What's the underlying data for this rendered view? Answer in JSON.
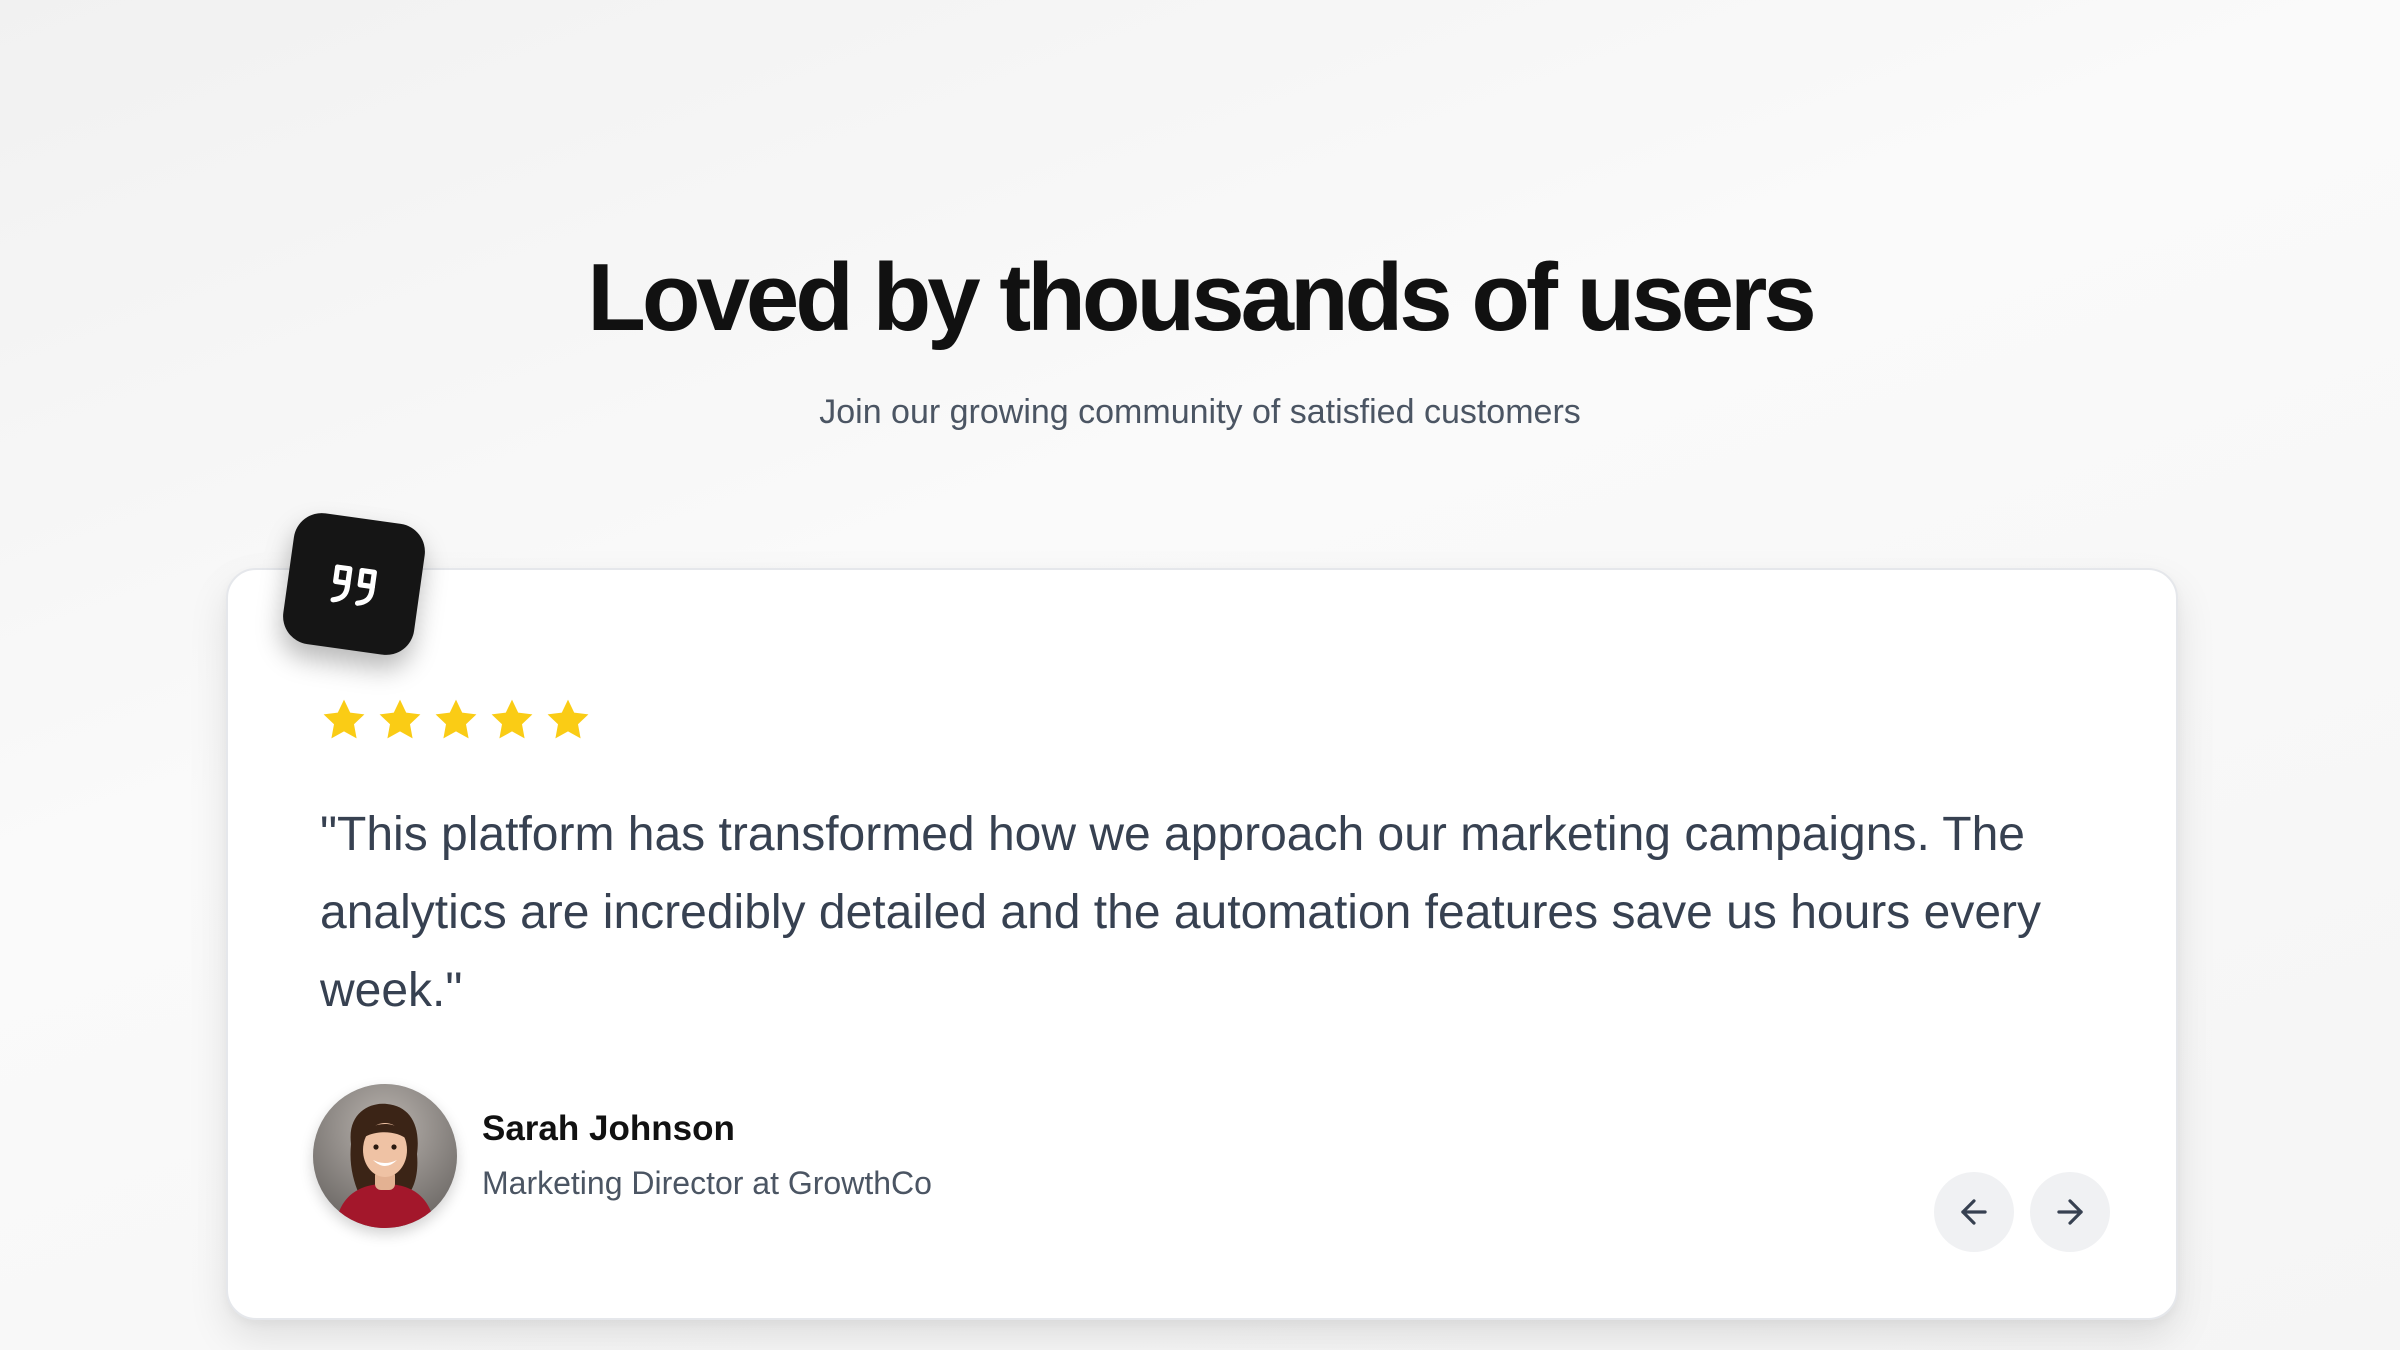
{
  "section": {
    "title": "Loved by thousands of users",
    "subtitle": "Join our growing community of satisfied customers"
  },
  "testimonial": {
    "quote_icon": "quote-icon",
    "rating": 5,
    "rating_max": 5,
    "star_icon": "star-icon",
    "quote": "\"This platform has transformed how we approach our marketing campaigns. The analytics are incredibly detailed and the automation features save us hours every week.\"",
    "author": {
      "name": "Sarah Johnson",
      "role": "Marketing Director at GrowthCo",
      "avatar_icon": "avatar-photo"
    }
  },
  "navigation": {
    "prev_icon": "arrow-left-icon",
    "next_icon": "arrow-right-icon"
  },
  "colors": {
    "star": "#FACC15",
    "badge": "#151515",
    "title": "#111111",
    "body_text": "#374151",
    "muted_text": "#4B5563",
    "nav_button_bg": "#F0F1F3"
  }
}
